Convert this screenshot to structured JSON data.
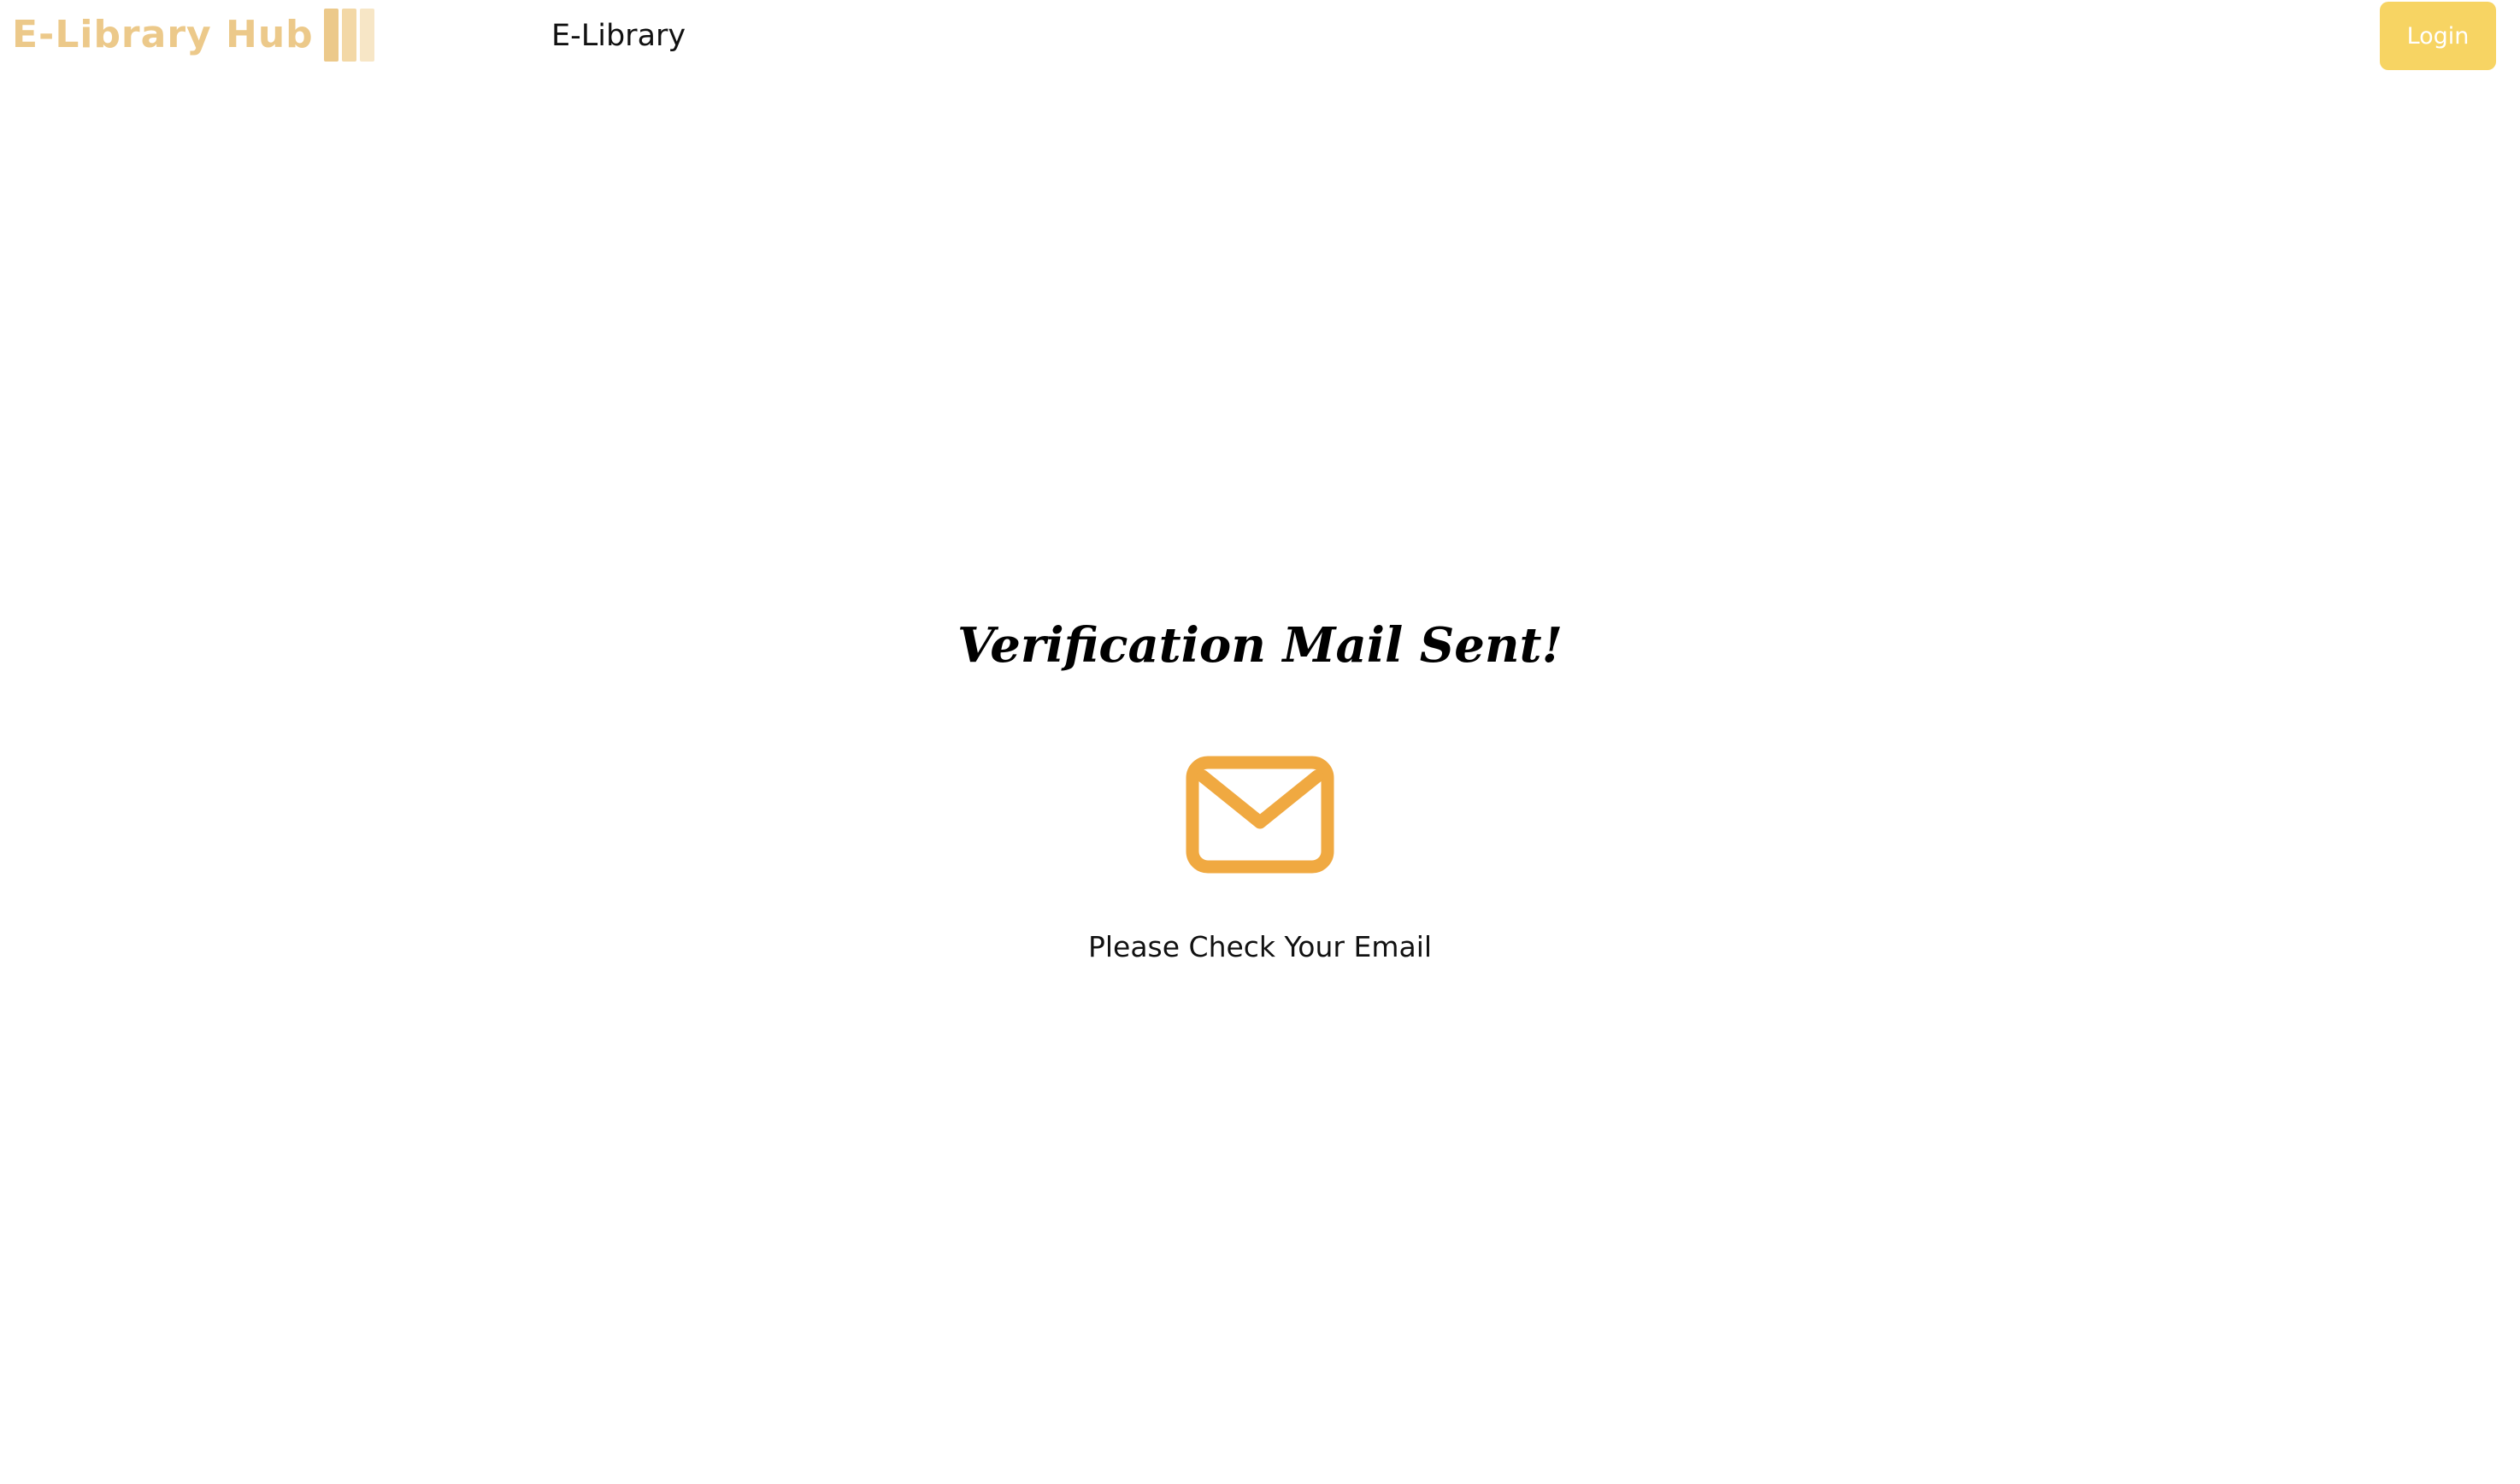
{
  "header": {
    "logo_text": "E-Library Hub",
    "brand_link": "E-Library",
    "login_label": "Login"
  },
  "main": {
    "title": "Verification Mail Sent!",
    "message": "Please Check Your Email",
    "icon": "mail-icon"
  },
  "colors": {
    "logo_text": "#ecc98a",
    "logo_books": [
      "#ecc98a",
      "#f3d8a6",
      "#f7e6c6"
    ],
    "login_button": "#f7d463",
    "mail_icon": "#f0a941",
    "text": "#000000"
  }
}
